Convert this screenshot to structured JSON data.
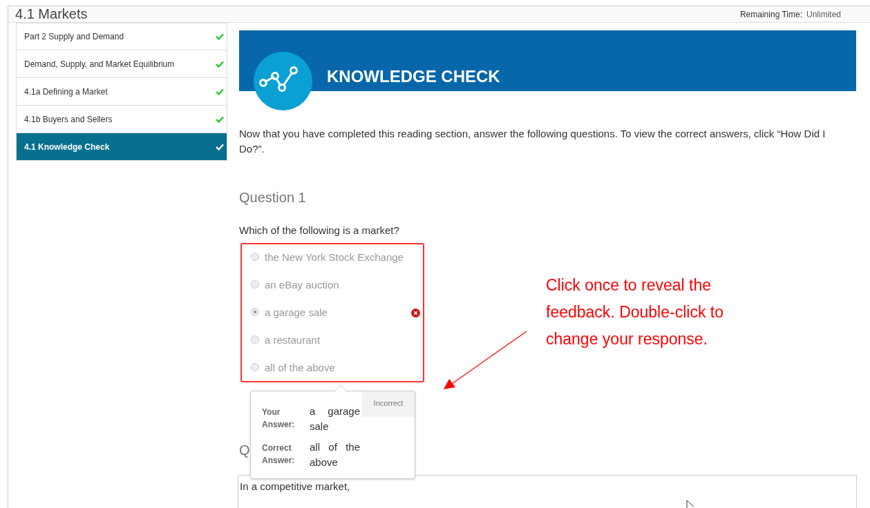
{
  "header": {
    "title": "4.1 Markets",
    "time_label": "Remaining Time:",
    "time_value": "Unlimited"
  },
  "sidebar": {
    "items": [
      {
        "label": "Part 2 Supply and Demand",
        "completed": true,
        "selected": false
      },
      {
        "label": "Demand, Supply, and Market Equilibrium",
        "completed": true,
        "selected": false
      },
      {
        "label": "4.1a Defining a Market",
        "completed": true,
        "selected": false
      },
      {
        "label": "4.1b Buyers and Sellers",
        "completed": true,
        "selected": false
      },
      {
        "label": "4.1 Knowledge Check",
        "completed": true,
        "selected": true
      }
    ]
  },
  "banner": {
    "title": "KNOWLEDGE CHECK"
  },
  "intro": "Now that you have completed this reading section, answer the following questions. To view the correct answers, click “How Did I Do?”.",
  "question_1": {
    "heading": "Question 1",
    "prompt": "Which of the following is a market?",
    "options": [
      {
        "label": "the New York Stock Exchange",
        "selected": false,
        "marked_wrong": false
      },
      {
        "label": "an eBay auction",
        "selected": false,
        "marked_wrong": false
      },
      {
        "label": "a garage sale",
        "selected": true,
        "marked_wrong": true
      },
      {
        "label": "a restaurant",
        "selected": false,
        "marked_wrong": false
      },
      {
        "label": "all of the above",
        "selected": false,
        "marked_wrong": false
      }
    ],
    "feedback": {
      "status": "Incorrect",
      "rows": [
        {
          "label": "Your Answer:",
          "value": "a garage sale"
        },
        {
          "label": "Correct Answer:",
          "value": "all of the above"
        }
      ]
    }
  },
  "question_2": {
    "heading": "Q",
    "prompt": "In a competitive market,"
  },
  "annotation": {
    "text": "Click once to reveal the feedback. Double-click to change your response."
  }
}
